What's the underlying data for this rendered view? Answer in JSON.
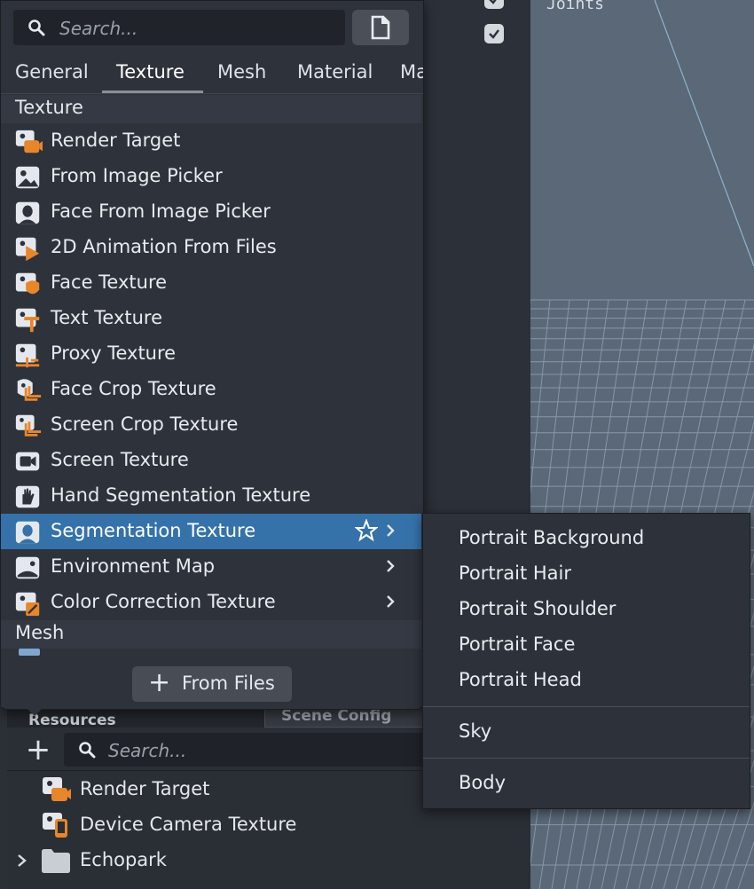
{
  "viewport": {
    "label": "Joints"
  },
  "popup": {
    "search": {
      "placeholder": "Search..."
    },
    "tabs": [
      {
        "label": "General"
      },
      {
        "label": "Texture",
        "active": true
      },
      {
        "label": "Mesh"
      },
      {
        "label": "Material"
      },
      {
        "label": "Ma"
      }
    ],
    "sections": [
      {
        "title": "Texture"
      },
      {
        "title": "Mesh"
      }
    ],
    "items": [
      {
        "label": "Render Target",
        "icon": "render-target-icon"
      },
      {
        "label": "From Image Picker",
        "icon": "image-icon"
      },
      {
        "label": "Face From Image Picker",
        "icon": "face-image-icon"
      },
      {
        "label": "2D Animation From Files",
        "icon": "animation-icon"
      },
      {
        "label": "Face Texture",
        "icon": "face-texture-icon"
      },
      {
        "label": "Text Texture",
        "icon": "text-texture-icon"
      },
      {
        "label": "Proxy Texture",
        "icon": "proxy-texture-icon"
      },
      {
        "label": "Face Crop Texture",
        "icon": "face-crop-icon"
      },
      {
        "label": "Screen Crop Texture",
        "icon": "screen-crop-icon"
      },
      {
        "label": "Screen Texture",
        "icon": "screen-texture-icon"
      },
      {
        "label": "Hand Segmentation Texture",
        "icon": "hand-icon"
      },
      {
        "label": "Segmentation Texture",
        "icon": "segmentation-icon",
        "selected": true,
        "submenu": true
      },
      {
        "label": "Environment Map",
        "icon": "environment-map-icon",
        "submenu": true
      },
      {
        "label": "Color Correction Texture",
        "icon": "color-correction-icon",
        "submenu": true
      }
    ],
    "footer": {
      "from_files_label": "From Files"
    }
  },
  "submenu": {
    "items": [
      {
        "label": "Portrait Background"
      },
      {
        "label": "Portrait Hair"
      },
      {
        "label": "Portrait Shoulder"
      },
      {
        "label": "Portrait Face"
      },
      {
        "label": "Portrait Head"
      },
      {
        "label": "Sky"
      },
      {
        "label": "Body"
      }
    ]
  },
  "resources": {
    "tabs": [
      {
        "label": "Resources"
      },
      {
        "label": "Scene Config"
      }
    ],
    "search": {
      "placeholder": "Search..."
    },
    "rows": [
      {
        "label": "Render Target",
        "icon": "render-target-icon"
      },
      {
        "label": "Device Camera Texture",
        "icon": "device-camera-icon"
      },
      {
        "label": "Echopark",
        "icon": "folder-icon"
      }
    ]
  },
  "colors": {
    "accent": "#3572a9",
    "orange": "#e8862a",
    "icon_light": "#e4e8ee"
  }
}
